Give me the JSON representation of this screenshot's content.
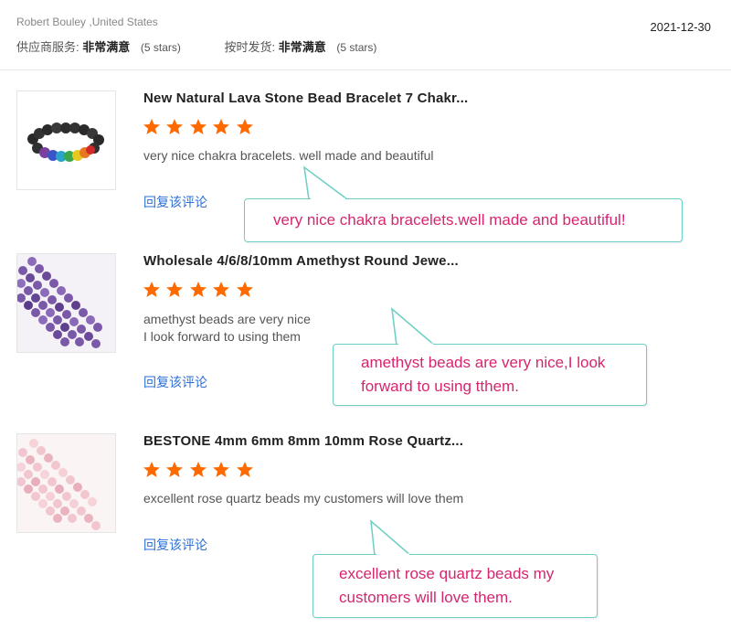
{
  "header": {
    "reviewer": "Robert Bouley ,United States",
    "date": "2021-12-30",
    "ratings": [
      {
        "label": "供应商服务:",
        "value": "非常满意",
        "count": "(5 stars)"
      },
      {
        "label": "按时发货:",
        "value": "非常满意",
        "count": "(5 stars)"
      }
    ]
  },
  "reviews": [
    {
      "title": "New Natural Lava Stone Bead Bracelet 7 Chakr...",
      "rating": 5,
      "text_lines": [
        "very nice chakra bracelets. well made and beautiful"
      ],
      "reply_label": "回复该评论",
      "callout_lines": [
        "very nice chakra bracelets.well made and beautiful!"
      ]
    },
    {
      "title": "Wholesale 4/6/8/10mm Amethyst Round Jewe...",
      "rating": 5,
      "text_lines": [
        "amethyst beads are very nice",
        "I look forward to using them"
      ],
      "reply_label": "回复该评论",
      "callout_lines": [
        "amethyst beads are very nice,I look",
        "forward to using tthem."
      ]
    },
    {
      "title": "BESTONE 4mm 6mm 8mm 10mm Rose Quartz...",
      "rating": 5,
      "text_lines": [
        "excellent rose quartz beads my customers will love them"
      ],
      "reply_label": "回复该评论",
      "callout_lines": [
        "excellent rose quartz beads my",
        "customers will love them."
      ]
    }
  ],
  "colors": {
    "star": "#ff6a00",
    "link": "#2d6fd6",
    "callout_border": "#6ccfc3",
    "callout_text": "#d6256e"
  }
}
